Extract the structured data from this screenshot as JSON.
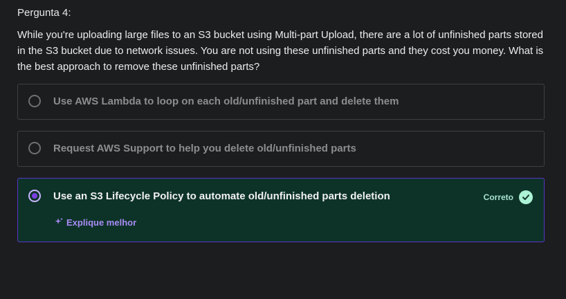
{
  "question": {
    "number": "Pergunta 4:",
    "text": "While you're uploading large files to an S3 bucket using Multi-part Upload, there are a lot of unfinished parts stored in the S3 bucket due to network issues. You are not using these unfinished parts and they cost you money. What is the best approach to remove these unfinished parts?"
  },
  "options": [
    {
      "label": "Use AWS Lambda to loop on each old/unfinished part and delete them",
      "selected": false
    },
    {
      "label": "Request AWS Support to help you delete old/unfinished parts",
      "selected": false
    },
    {
      "label": "Use an S3 Lifecycle Policy to automate old/unfinished parts deletion",
      "selected": true
    }
  ],
  "result": {
    "status_label": "Correto",
    "status_icon": "check-circle-icon",
    "explain_label": "Explique melhor",
    "explain_icon": "sparkle-icon"
  },
  "colors": {
    "background": "#1c1d1f",
    "correct_bg": "#0d3328",
    "selected_border": "#5b34c9",
    "accent_purple": "#a98bf5",
    "correct_green": "#acf2d6"
  }
}
